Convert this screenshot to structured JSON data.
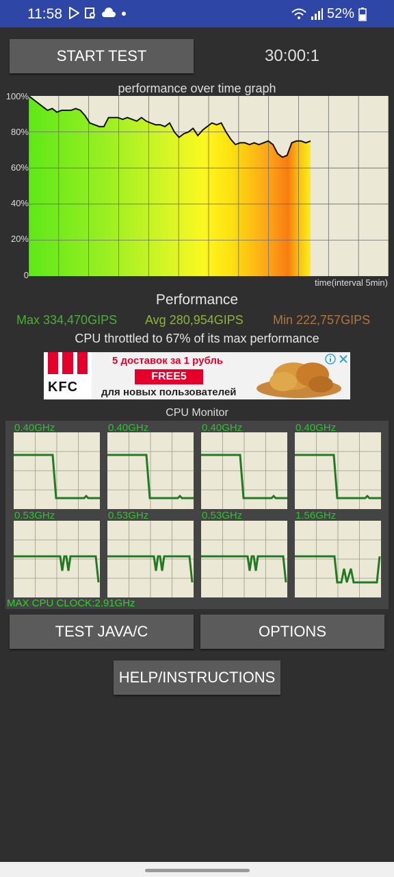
{
  "status_bar": {
    "time": "11:58",
    "battery": "52%",
    "icons": [
      "play-store-icon",
      "screenshot-icon",
      "cloud-icon",
      "dot-icon",
      "wifi-icon",
      "signal-icon",
      "battery-icon"
    ]
  },
  "controls": {
    "start_label": "START TEST",
    "timer": "30:00:1"
  },
  "graph": {
    "title": "performance over time graph",
    "y_ticks": [
      "100%",
      "80%",
      "60%",
      "40%",
      "20%",
      "0"
    ],
    "x_label": "time(interval 5min)"
  },
  "chart_data": {
    "type": "area",
    "title": "performance over time graph",
    "xlabel": "time(interval 5min)",
    "ylabel": "",
    "ylim": [
      0,
      100
    ],
    "grid": true,
    "x": [
      0,
      0.5,
      1,
      1.5,
      2,
      2.5,
      3,
      3.5,
      4,
      4.5,
      5,
      5.5,
      6,
      6.5,
      7,
      7.5,
      8,
      8.5,
      9,
      9.5,
      10,
      10.5,
      11,
      11.5,
      12,
      12.5,
      13,
      13.5,
      14,
      14.5,
      15,
      15.5,
      16,
      16.5,
      17,
      17.5,
      18,
      18.5,
      19,
      19.5,
      20,
      20.5,
      21,
      21.5,
      22,
      22.5,
      23,
      23.5,
      24,
      24.5,
      25,
      25.5,
      26,
      26.5,
      27,
      27.5,
      28,
      28.5,
      29,
      29.5,
      30
    ],
    "series": [
      {
        "values": [
          100,
          98,
          96,
          94,
          92,
          93,
          91,
          92,
          92,
          92,
          93,
          92,
          89,
          85,
          84,
          83,
          83,
          88,
          88,
          88,
          87,
          88,
          87,
          86,
          88,
          86,
          85,
          84,
          84,
          83,
          85,
          80,
          77,
          79,
          80,
          82,
          78,
          81,
          83,
          85,
          84,
          85,
          80,
          76,
          73,
          74,
          74,
          73,
          74,
          73,
          74,
          75,
          73,
          68,
          66,
          67,
          74,
          75,
          75,
          74,
          75
        ]
      }
    ]
  },
  "performance": {
    "title": "Performance",
    "max": "Max 334,470GIPS",
    "avg": "Avg 280,954GIPS",
    "min": "Min 222,757GIPS",
    "throttle": "CPU throttled to 67% of its max performance",
    "colors": {
      "max": "#4cae3a",
      "avg": "#8eb43a",
      "min": "#b0763c"
    }
  },
  "ad": {
    "brand": "KFC",
    "line1": "5 доставок за 1 рубль",
    "promo": "FREE5",
    "line3": "для новых пользователей"
  },
  "cpu_monitor": {
    "title": "CPU Monitor",
    "cores": [
      {
        "freq": "0.40GHz"
      },
      {
        "freq": "0.40GHz"
      },
      {
        "freq": "0.40GHz"
      },
      {
        "freq": "0.40GHz"
      },
      {
        "freq": "0.53GHz"
      },
      {
        "freq": "0.53GHz"
      },
      {
        "freq": "0.53GHz"
      },
      {
        "freq": "1.56GHz"
      }
    ],
    "max_clock": "MAX CPU CLOCK:2.91GHz"
  },
  "buttons": {
    "test_java": "TEST JAVA/C",
    "options": "OPTIONS",
    "help": "HELP/INSTRUCTIONS"
  }
}
